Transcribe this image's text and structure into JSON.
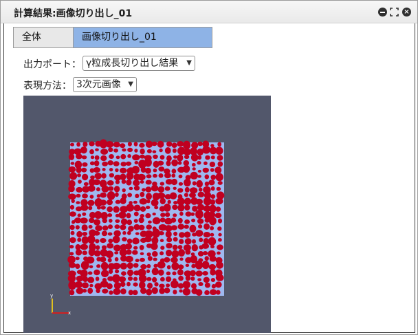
{
  "window": {
    "title": "計算結果:画像切り出し_01",
    "controls": {
      "minimize_icon": "minimize-icon",
      "maximize_icon": "maximize-icon",
      "close_icon": "close-icon"
    }
  },
  "tabs": [
    {
      "label": "全体",
      "active": false
    },
    {
      "label": "画像切り出し_01",
      "active": true
    }
  ],
  "output_port": {
    "label": "出力ポート：",
    "selected": "γ粒成長切り出し結果"
  },
  "representation": {
    "label": "表現方法：",
    "selected": "3次元画像"
  },
  "viewport": {
    "background": "#52576b",
    "grain_color": "#c00020",
    "boundary_color": "#9fb8f0",
    "axes": {
      "x": "x",
      "y": "y",
      "x_color": "#d02020",
      "y_color": "#e0c020"
    }
  }
}
